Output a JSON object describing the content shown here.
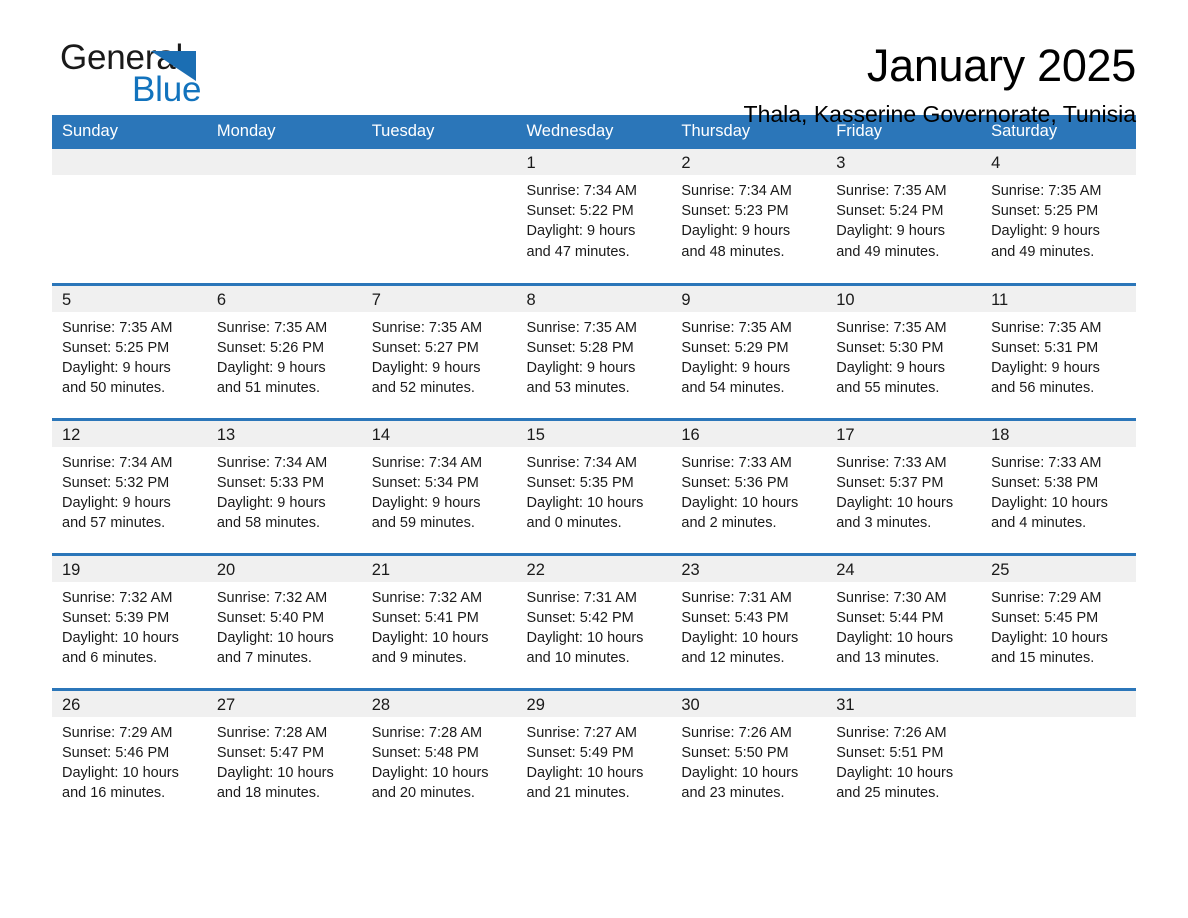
{
  "logo": {
    "word_one": "General",
    "word_two": "Blue",
    "triangle_color": "#1b6eb3",
    "blue_color": "#1273bd"
  },
  "header": {
    "month_title": "January 2025",
    "location": "Thala, Kasserine Governorate, Tunisia"
  },
  "theme": {
    "header_blue": "#2b76b9",
    "daynum_band": "#f0f0f0",
    "text": "#1a1a1a"
  },
  "weekday_headers": [
    "Sunday",
    "Monday",
    "Tuesday",
    "Wednesday",
    "Thursday",
    "Friday",
    "Saturday"
  ],
  "weeks": [
    [
      {
        "day": "",
        "sunrise": "",
        "sunset": "",
        "daylight": "",
        "empty": true
      },
      {
        "day": "",
        "sunrise": "",
        "sunset": "",
        "daylight": "",
        "empty": true
      },
      {
        "day": "",
        "sunrise": "",
        "sunset": "",
        "daylight": "",
        "empty": true
      },
      {
        "day": "1",
        "sunrise": "Sunrise: 7:34 AM",
        "sunset": "Sunset: 5:22 PM",
        "daylight": "Daylight: 9 hours and 47 minutes.",
        "empty": false
      },
      {
        "day": "2",
        "sunrise": "Sunrise: 7:34 AM",
        "sunset": "Sunset: 5:23 PM",
        "daylight": "Daylight: 9 hours and 48 minutes.",
        "empty": false
      },
      {
        "day": "3",
        "sunrise": "Sunrise: 7:35 AM",
        "sunset": "Sunset: 5:24 PM",
        "daylight": "Daylight: 9 hours and 49 minutes.",
        "empty": false
      },
      {
        "day": "4",
        "sunrise": "Sunrise: 7:35 AM",
        "sunset": "Sunset: 5:25 PM",
        "daylight": "Daylight: 9 hours and 49 minutes.",
        "empty": false
      }
    ],
    [
      {
        "day": "5",
        "sunrise": "Sunrise: 7:35 AM",
        "sunset": "Sunset: 5:25 PM",
        "daylight": "Daylight: 9 hours and 50 minutes.",
        "empty": false
      },
      {
        "day": "6",
        "sunrise": "Sunrise: 7:35 AM",
        "sunset": "Sunset: 5:26 PM",
        "daylight": "Daylight: 9 hours and 51 minutes.",
        "empty": false
      },
      {
        "day": "7",
        "sunrise": "Sunrise: 7:35 AM",
        "sunset": "Sunset: 5:27 PM",
        "daylight": "Daylight: 9 hours and 52 minutes.",
        "empty": false
      },
      {
        "day": "8",
        "sunrise": "Sunrise: 7:35 AM",
        "sunset": "Sunset: 5:28 PM",
        "daylight": "Daylight: 9 hours and 53 minutes.",
        "empty": false
      },
      {
        "day": "9",
        "sunrise": "Sunrise: 7:35 AM",
        "sunset": "Sunset: 5:29 PM",
        "daylight": "Daylight: 9 hours and 54 minutes.",
        "empty": false
      },
      {
        "day": "10",
        "sunrise": "Sunrise: 7:35 AM",
        "sunset": "Sunset: 5:30 PM",
        "daylight": "Daylight: 9 hours and 55 minutes.",
        "empty": false
      },
      {
        "day": "11",
        "sunrise": "Sunrise: 7:35 AM",
        "sunset": "Sunset: 5:31 PM",
        "daylight": "Daylight: 9 hours and 56 minutes.",
        "empty": false
      }
    ],
    [
      {
        "day": "12",
        "sunrise": "Sunrise: 7:34 AM",
        "sunset": "Sunset: 5:32 PM",
        "daylight": "Daylight: 9 hours and 57 minutes.",
        "empty": false
      },
      {
        "day": "13",
        "sunrise": "Sunrise: 7:34 AM",
        "sunset": "Sunset: 5:33 PM",
        "daylight": "Daylight: 9 hours and 58 minutes.",
        "empty": false
      },
      {
        "day": "14",
        "sunrise": "Sunrise: 7:34 AM",
        "sunset": "Sunset: 5:34 PM",
        "daylight": "Daylight: 9 hours and 59 minutes.",
        "empty": false
      },
      {
        "day": "15",
        "sunrise": "Sunrise: 7:34 AM",
        "sunset": "Sunset: 5:35 PM",
        "daylight": "Daylight: 10 hours and 0 minutes.",
        "empty": false
      },
      {
        "day": "16",
        "sunrise": "Sunrise: 7:33 AM",
        "sunset": "Sunset: 5:36 PM",
        "daylight": "Daylight: 10 hours and 2 minutes.",
        "empty": false
      },
      {
        "day": "17",
        "sunrise": "Sunrise: 7:33 AM",
        "sunset": "Sunset: 5:37 PM",
        "daylight": "Daylight: 10 hours and 3 minutes.",
        "empty": false
      },
      {
        "day": "18",
        "sunrise": "Sunrise: 7:33 AM",
        "sunset": "Sunset: 5:38 PM",
        "daylight": "Daylight: 10 hours and 4 minutes.",
        "empty": false
      }
    ],
    [
      {
        "day": "19",
        "sunrise": "Sunrise: 7:32 AM",
        "sunset": "Sunset: 5:39 PM",
        "daylight": "Daylight: 10 hours and 6 minutes.",
        "empty": false
      },
      {
        "day": "20",
        "sunrise": "Sunrise: 7:32 AM",
        "sunset": "Sunset: 5:40 PM",
        "daylight": "Daylight: 10 hours and 7 minutes.",
        "empty": false
      },
      {
        "day": "21",
        "sunrise": "Sunrise: 7:32 AM",
        "sunset": "Sunset: 5:41 PM",
        "daylight": "Daylight: 10 hours and 9 minutes.",
        "empty": false
      },
      {
        "day": "22",
        "sunrise": "Sunrise: 7:31 AM",
        "sunset": "Sunset: 5:42 PM",
        "daylight": "Daylight: 10 hours and 10 minutes.",
        "empty": false
      },
      {
        "day": "23",
        "sunrise": "Sunrise: 7:31 AM",
        "sunset": "Sunset: 5:43 PM",
        "daylight": "Daylight: 10 hours and 12 minutes.",
        "empty": false
      },
      {
        "day": "24",
        "sunrise": "Sunrise: 7:30 AM",
        "sunset": "Sunset: 5:44 PM",
        "daylight": "Daylight: 10 hours and 13 minutes.",
        "empty": false
      },
      {
        "day": "25",
        "sunrise": "Sunrise: 7:29 AM",
        "sunset": "Sunset: 5:45 PM",
        "daylight": "Daylight: 10 hours and 15 minutes.",
        "empty": false
      }
    ],
    [
      {
        "day": "26",
        "sunrise": "Sunrise: 7:29 AM",
        "sunset": "Sunset: 5:46 PM",
        "daylight": "Daylight: 10 hours and 16 minutes.",
        "empty": false
      },
      {
        "day": "27",
        "sunrise": "Sunrise: 7:28 AM",
        "sunset": "Sunset: 5:47 PM",
        "daylight": "Daylight: 10 hours and 18 minutes.",
        "empty": false
      },
      {
        "day": "28",
        "sunrise": "Sunrise: 7:28 AM",
        "sunset": "Sunset: 5:48 PM",
        "daylight": "Daylight: 10 hours and 20 minutes.",
        "empty": false
      },
      {
        "day": "29",
        "sunrise": "Sunrise: 7:27 AM",
        "sunset": "Sunset: 5:49 PM",
        "daylight": "Daylight: 10 hours and 21 minutes.",
        "empty": false
      },
      {
        "day": "30",
        "sunrise": "Sunrise: 7:26 AM",
        "sunset": "Sunset: 5:50 PM",
        "daylight": "Daylight: 10 hours and 23 minutes.",
        "empty": false
      },
      {
        "day": "31",
        "sunrise": "Sunrise: 7:26 AM",
        "sunset": "Sunset: 5:51 PM",
        "daylight": "Daylight: 10 hours and 25 minutes.",
        "empty": false
      },
      {
        "day": "",
        "sunrise": "",
        "sunset": "",
        "daylight": "",
        "empty": true
      }
    ]
  ]
}
